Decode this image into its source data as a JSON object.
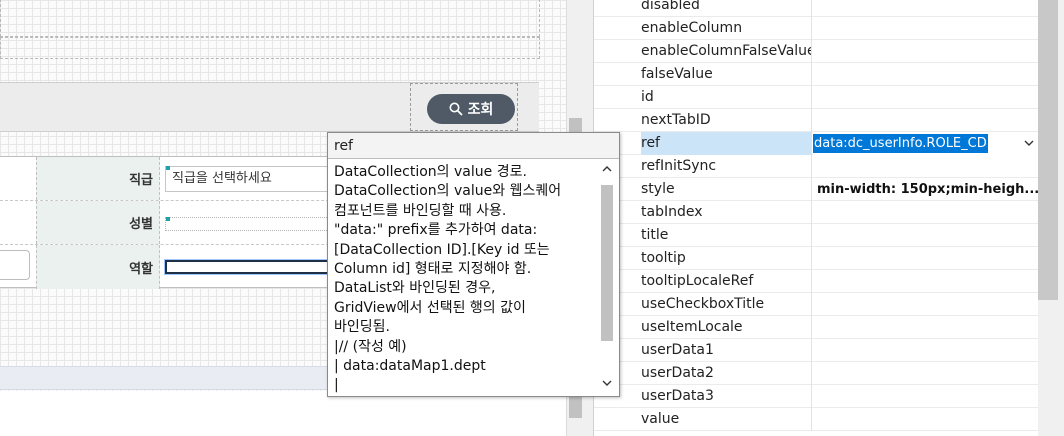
{
  "search": {
    "button_label": "조회"
  },
  "form": {
    "rows": [
      {
        "label": "직급",
        "value": "직급을 선택하세요"
      },
      {
        "label": "성별",
        "value": ""
      },
      {
        "label": "역할",
        "value": ""
      }
    ]
  },
  "properties": [
    {
      "name": "disabled",
      "value": ""
    },
    {
      "name": "enableColumn",
      "value": ""
    },
    {
      "name": "enableColumnFalseValue",
      "value": ""
    },
    {
      "name": "falseValue",
      "value": ""
    },
    {
      "name": "id",
      "value": ""
    },
    {
      "name": "nextTabID",
      "value": ""
    },
    {
      "name": "ref",
      "value": "data:dc_userInfo.ROLE_CD",
      "selected": true
    },
    {
      "name": "refInitSync",
      "value": ""
    },
    {
      "name": "style",
      "value": "min-width: 150px;min-heigh..."
    },
    {
      "name": "tabIndex",
      "value": ""
    },
    {
      "name": "title",
      "value": ""
    },
    {
      "name": "tooltip",
      "value": ""
    },
    {
      "name": "tooltipLocaleRef",
      "value": ""
    },
    {
      "name": "useCheckboxTitle",
      "value": ""
    },
    {
      "name": "useItemLocale",
      "value": ""
    },
    {
      "name": "userData1",
      "value": ""
    },
    {
      "name": "userData2",
      "value": ""
    },
    {
      "name": "userData3",
      "value": ""
    },
    {
      "name": "value",
      "value": ""
    }
  ],
  "tooltip": {
    "title": "ref",
    "lines": [
      "DataCollection의 value 경로.",
      "DataCollection의 value와 웹스퀘어",
      "컴포넌트를 바인딩할 때 사용.",
      " \"data:\" prefix를 추가하여 data:",
      "[DataCollection ID].[Key id 또는",
      "Column id] 형태로 지정해야 함.",
      " DataList와 바인딩된 경우,",
      "GridView에서 선택된 행의 값이",
      "바인딩됨.",
      " |// (작성 예)",
      " | data:dataMap1.dept",
      " |"
    ]
  },
  "colors": {
    "selection": "#0078d7",
    "selected_row": "#cce4f7",
    "search_button": "#4f5a66",
    "label_cell": "#eaf1ee"
  },
  "icons": {
    "search": "magnifier-icon",
    "dropdown": "chevron-down-icon",
    "scroll_up": "chevron-up-icon",
    "scroll_down": "chevron-down-icon"
  }
}
